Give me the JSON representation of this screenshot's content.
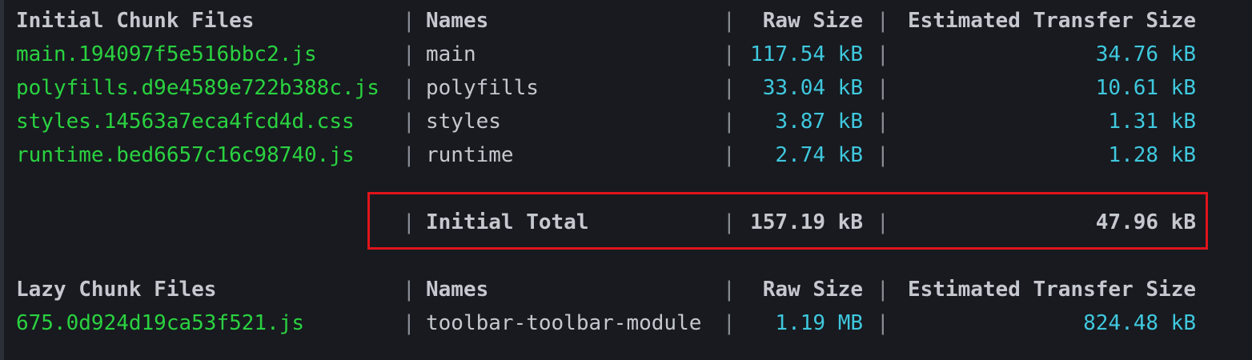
{
  "initial_section": {
    "headers": {
      "files": "Initial Chunk Files",
      "names": "Names",
      "raw_size": "Raw Size",
      "transfer_size": "Estimated Transfer Size"
    },
    "rows": [
      {
        "file": "main.194097f5e516bbc2.js",
        "name": "main",
        "raw": "117.54 kB",
        "transfer": "34.76 kB"
      },
      {
        "file": "polyfills.d9e4589e722b388c.js",
        "name": "polyfills",
        "raw": "33.04 kB",
        "transfer": "10.61 kB"
      },
      {
        "file": "styles.14563a7eca4fcd4d.css",
        "name": "styles",
        "raw": "3.87 kB",
        "transfer": "1.31 kB"
      },
      {
        "file": "runtime.bed6657c16c98740.js",
        "name": "runtime",
        "raw": "2.74 kB",
        "transfer": "1.28 kB"
      }
    ],
    "total": {
      "label": "Initial Total",
      "raw": "157.19 kB",
      "transfer": "47.96 kB"
    }
  },
  "lazy_section": {
    "headers": {
      "files": "Lazy Chunk Files",
      "names": "Names",
      "raw_size": "Raw Size",
      "transfer_size": "Estimated Transfer Size"
    },
    "rows": [
      {
        "file": "675.0d924d19ca53f521.js",
        "name": "toolbar-toolbar-module",
        "raw": "1.19 MB",
        "transfer": "824.48 kB"
      }
    ]
  },
  "separator": "|",
  "colors": {
    "background": "#181a1f",
    "file_name": "#2ad240",
    "size_value": "#3fc8de",
    "header_text": "#c5c8cf",
    "highlight_border": "#e0141b"
  }
}
